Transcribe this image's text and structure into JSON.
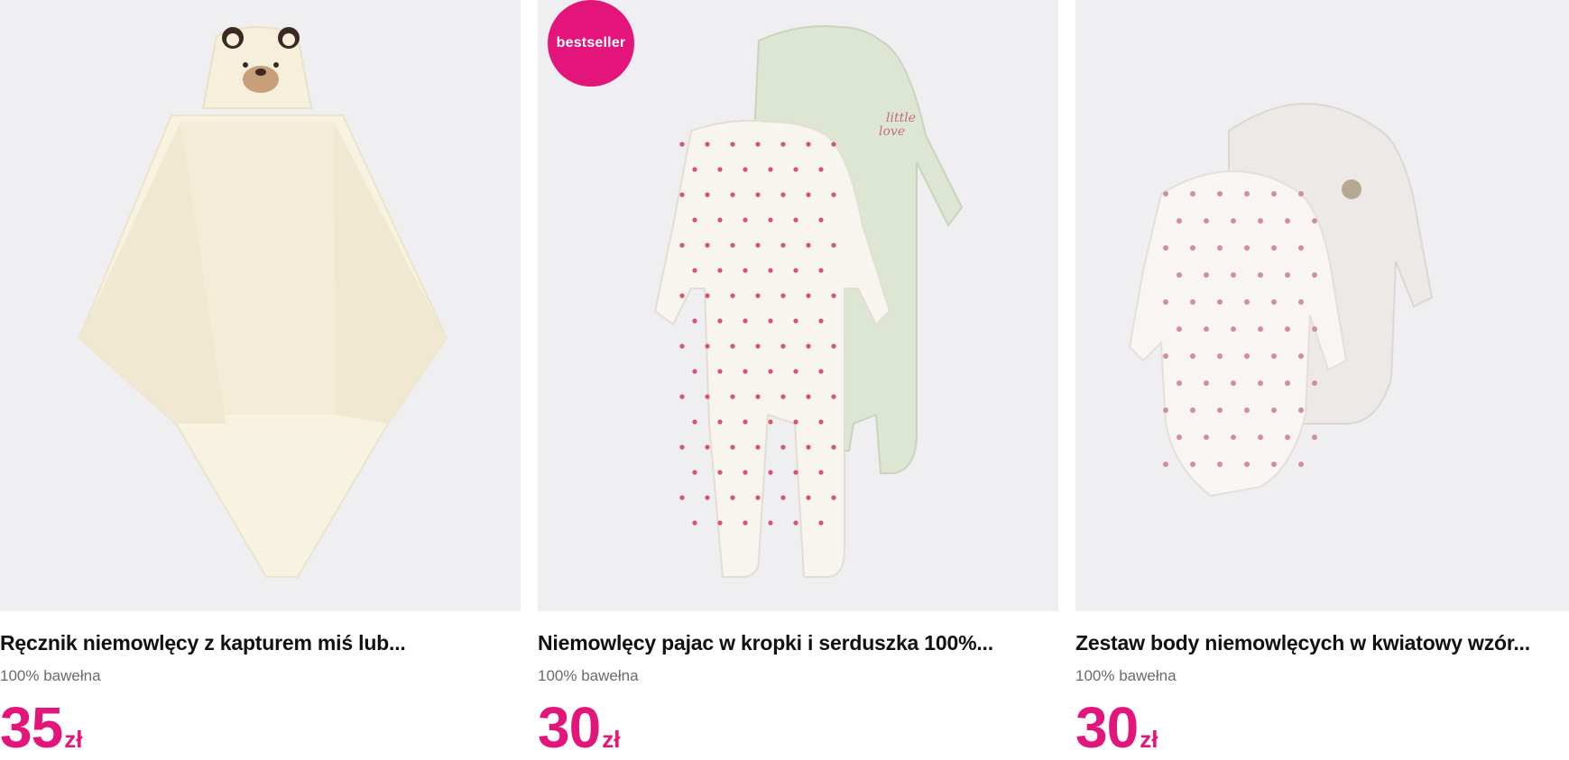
{
  "products": [
    {
      "image_label": "Ręcznik niemowlęcy z kapturem miś lub...",
      "title": "Ręcznik niemowlęcy z kapturem miś lub...",
      "material": "100% bawełna",
      "price": "35",
      "currency": "zł"
    },
    {
      "badge": "bestseller",
      "title": "Niemowlęcy pajac w kropki i serduszka 100%...",
      "material": "100% bawełna",
      "price": "30",
      "currency": "zł"
    },
    {
      "title": "Zestaw body niemowlęcych w kwiatowy wzór...",
      "material": "100% bawełna",
      "price": "30",
      "currency": "zł"
    }
  ],
  "colors": {
    "accent": "#e4157a",
    "image_bg": "#efeff1",
    "title": "#111111",
    "muted": "#6b6b6b"
  }
}
